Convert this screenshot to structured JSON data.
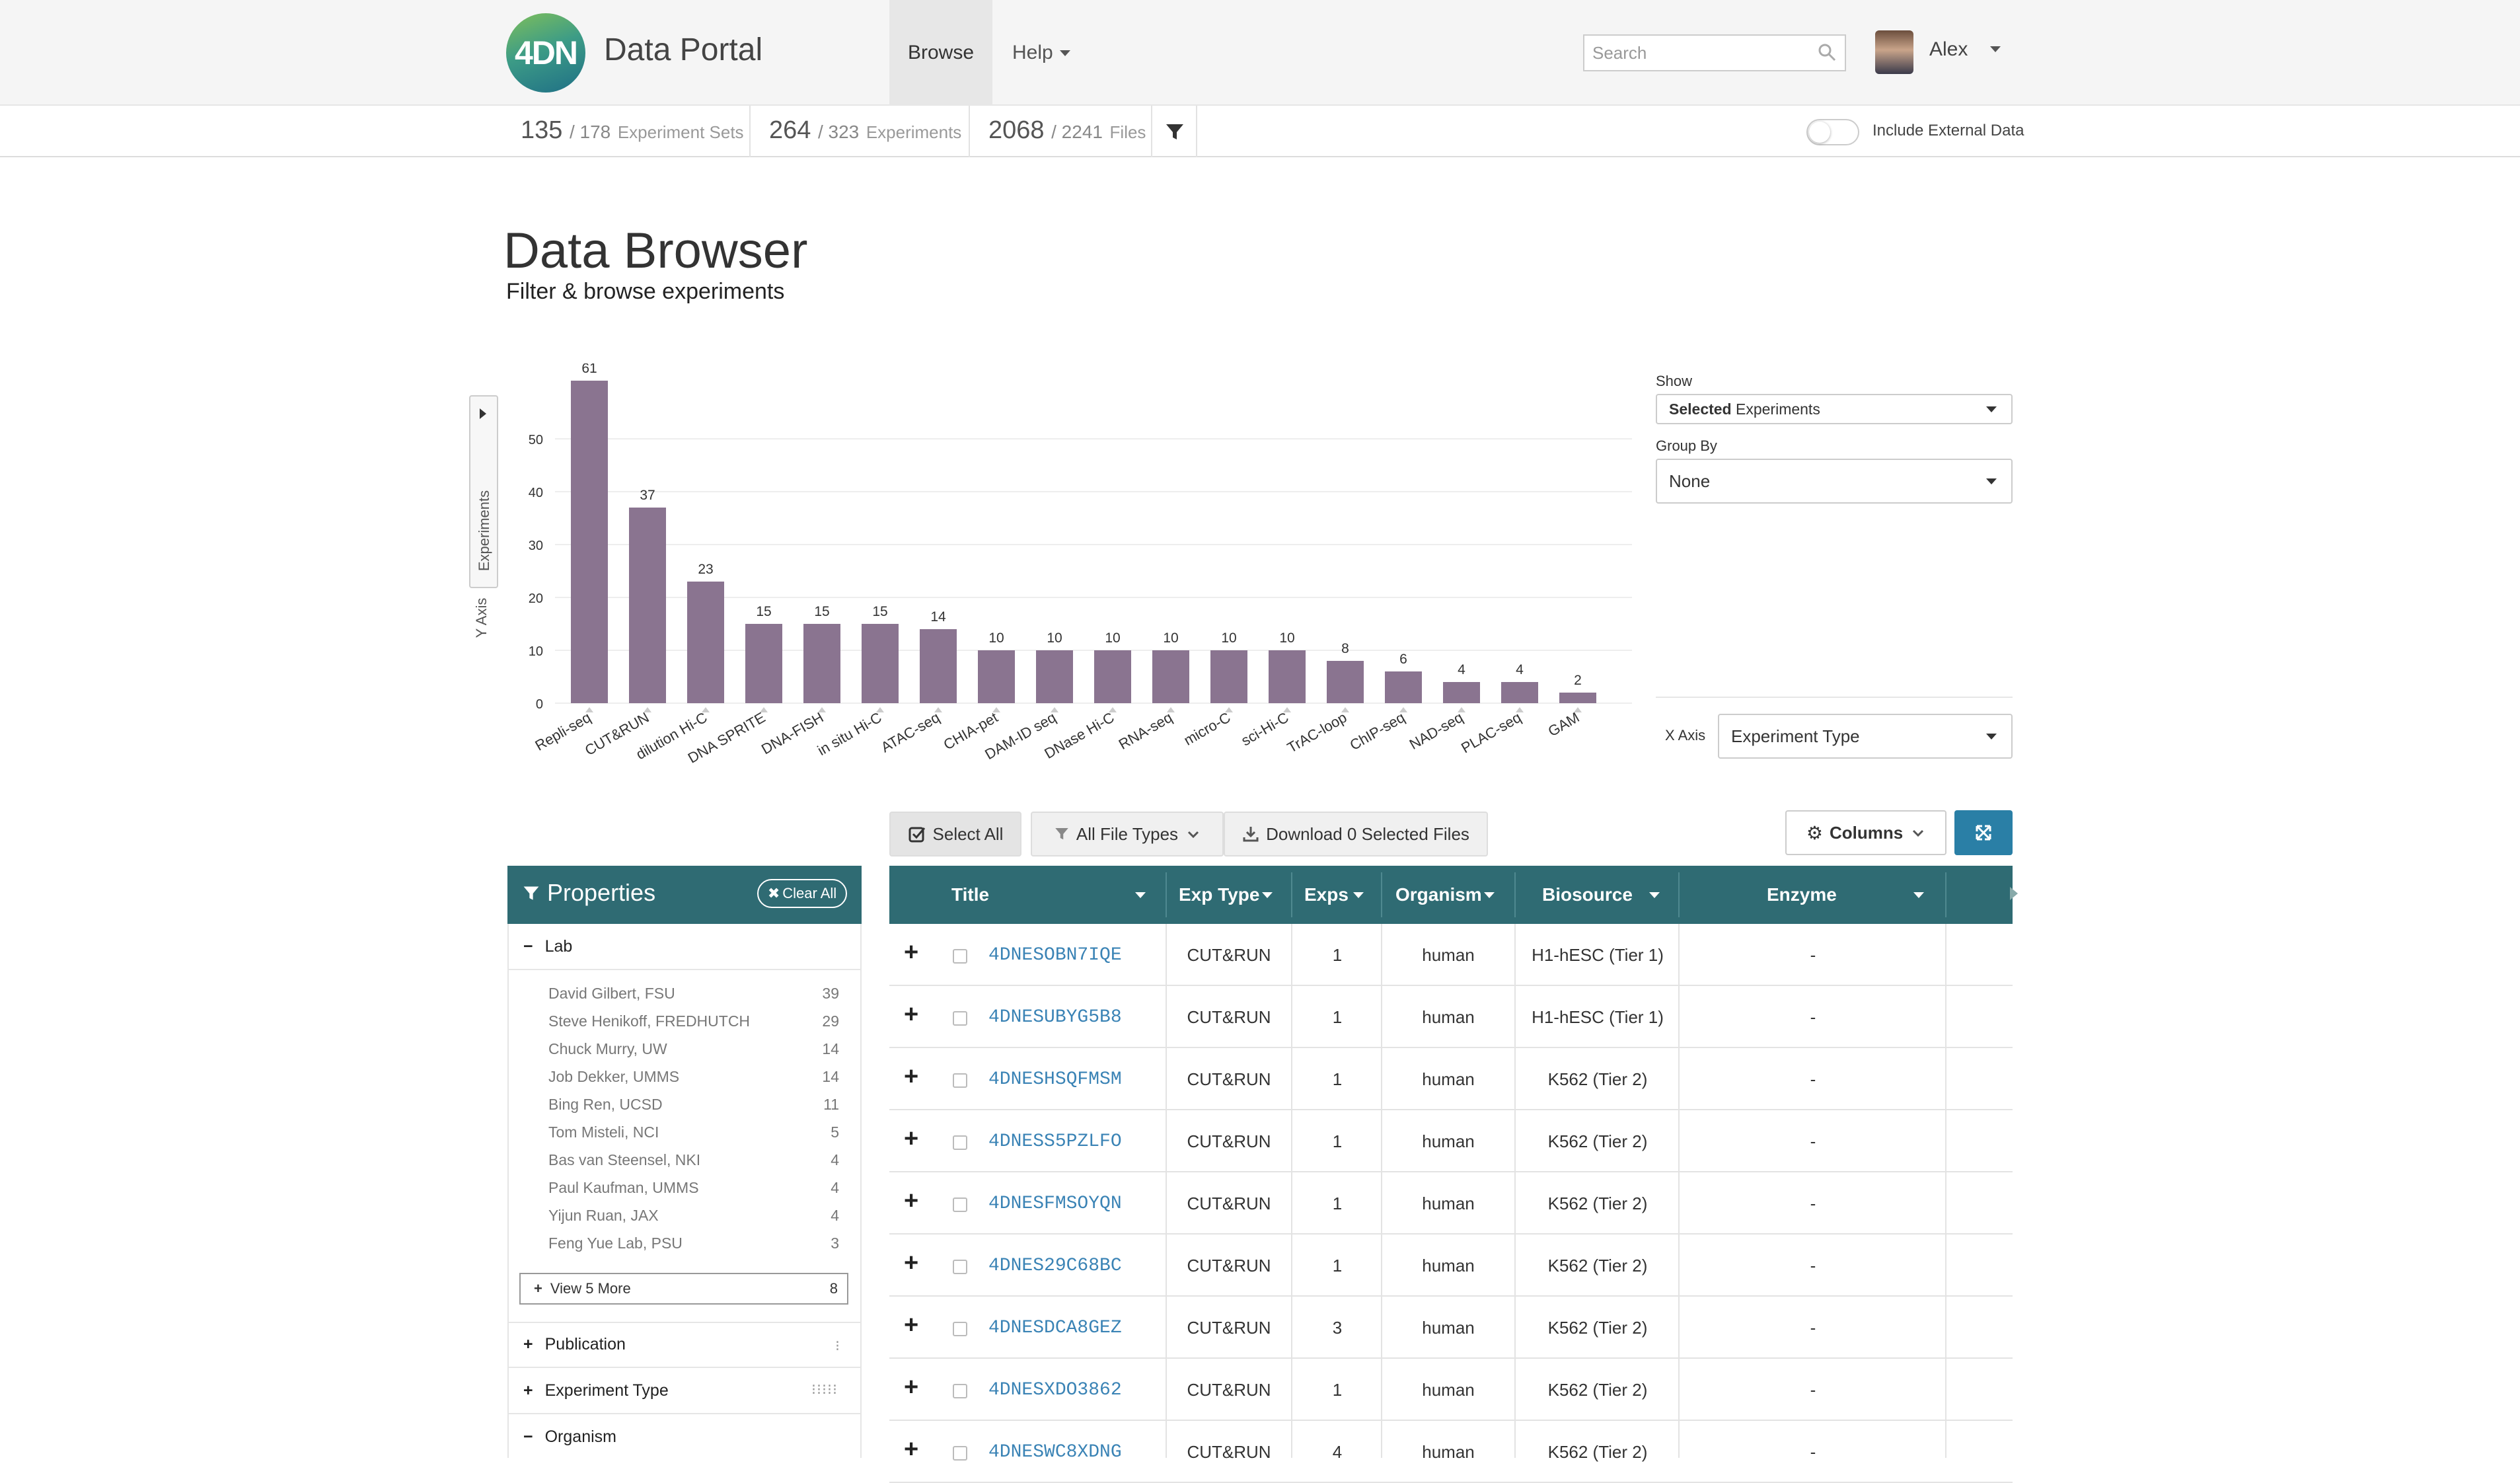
{
  "nav": {
    "logo_text": "4DN",
    "brand": "Data Portal",
    "browse": "Browse",
    "help": "Help",
    "search_placeholder": "Search",
    "user_name": "Alex"
  },
  "stats": {
    "experiment_sets": {
      "count": "135",
      "total": "/ 178",
      "label": "Experiment Sets"
    },
    "experiments": {
      "count": "264",
      "total": "/ 323",
      "label": "Experiments"
    },
    "files": {
      "count": "2068",
      "total": "/ 2241",
      "label": "Files"
    },
    "include_external": "Include External Data",
    "include_external_on": false
  },
  "page": {
    "title": "Data Browser",
    "subtitle": "Filter & browse experiments"
  },
  "chart_controls": {
    "y_axis_tab": "Experiments",
    "y_axis_label": "Y Axis",
    "show_label": "Show",
    "show_value_bold": "Selected",
    "show_value": "Experiments",
    "group_by_label": "Group By",
    "group_by_value": "None",
    "x_axis_label": "X Axis",
    "x_axis_value": "Experiment Type"
  },
  "chart_data": {
    "type": "bar",
    "categories": [
      "Repli-seq",
      "CUT&RUN",
      "dilution Hi-C",
      "DNA SPRITE",
      "DNA-FISH",
      "in situ Hi-C",
      "ATAC-seq",
      "CHIA-pet",
      "DAM-ID seq",
      "DNase Hi-C",
      "RNA-seq",
      "micro-C",
      "sci-Hi-C",
      "TrAC-loop",
      "ChIP-seq",
      "NAD-seq",
      "PLAC-seq",
      "GAM"
    ],
    "values": [
      61,
      37,
      23,
      15,
      15,
      15,
      14,
      10,
      10,
      10,
      10,
      10,
      10,
      8,
      6,
      4,
      4,
      2
    ],
    "ylim": [
      0,
      61
    ],
    "yticks": [
      0,
      10,
      20,
      30,
      40,
      50
    ],
    "ylabel": "Experiments",
    "bar_color": "#8a7490",
    "grid": true
  },
  "toolbar": {
    "select_all": "Select All",
    "file_types": "All File Types",
    "download": "Download 0 Selected Files",
    "columns": "Columns"
  },
  "properties": {
    "title": "Properties",
    "clear_all": "Clear All",
    "lab_heading": "Lab",
    "labs": [
      {
        "name": "David Gilbert, FSU",
        "count": "39"
      },
      {
        "name": "Steve Henikoff, FREDHUTCH",
        "count": "29"
      },
      {
        "name": "Chuck Murry, UW",
        "count": "14"
      },
      {
        "name": "Job Dekker, UMMS",
        "count": "14"
      },
      {
        "name": "Bing Ren, UCSD",
        "count": "11"
      },
      {
        "name": "Tom Misteli, NCI",
        "count": "5"
      },
      {
        "name": "Bas van Steensel, NKI",
        "count": "4"
      },
      {
        "name": "Paul Kaufman, UMMS",
        "count": "4"
      },
      {
        "name": "Yijun Ruan, JAX",
        "count": "4"
      },
      {
        "name": "Feng Yue Lab, PSU",
        "count": "3"
      }
    ],
    "view_more": "View 5 More",
    "view_more_count": "8",
    "publication": "Publication",
    "experiment_type": "Experiment Type",
    "organism": "Organism"
  },
  "table": {
    "headers": {
      "title": "Title",
      "exp_type": "Exp Type",
      "exps": "Exps",
      "organism": "Organism",
      "biosource": "Biosource",
      "enzyme": "Enzyme"
    },
    "rows": [
      {
        "accession": "4DNESOBN7IQE",
        "exp_type": "CUT&RUN",
        "exps": "1",
        "organism": "human",
        "biosource": "H1-hESC (Tier 1)",
        "enzyme": "-"
      },
      {
        "accession": "4DNESUBYG5B8",
        "exp_type": "CUT&RUN",
        "exps": "1",
        "organism": "human",
        "biosource": "H1-hESC (Tier 1)",
        "enzyme": "-"
      },
      {
        "accession": "4DNESHSQFMSM",
        "exp_type": "CUT&RUN",
        "exps": "1",
        "organism": "human",
        "biosource": "K562 (Tier 2)",
        "enzyme": "-"
      },
      {
        "accession": "4DNESS5PZLFO",
        "exp_type": "CUT&RUN",
        "exps": "1",
        "organism": "human",
        "biosource": "K562 (Tier 2)",
        "enzyme": "-"
      },
      {
        "accession": "4DNESFMSOYQN",
        "exp_type": "CUT&RUN",
        "exps": "1",
        "organism": "human",
        "biosource": "K562 (Tier 2)",
        "enzyme": "-"
      },
      {
        "accession": "4DNES29C68BC",
        "exp_type": "CUT&RUN",
        "exps": "1",
        "organism": "human",
        "biosource": "K562 (Tier 2)",
        "enzyme": "-"
      },
      {
        "accession": "4DNESDCA8GEZ",
        "exp_type": "CUT&RUN",
        "exps": "3",
        "organism": "human",
        "biosource": "K562 (Tier 2)",
        "enzyme": "-"
      },
      {
        "accession": "4DNESXDO3862",
        "exp_type": "CUT&RUN",
        "exps": "1",
        "organism": "human",
        "biosource": "K562 (Tier 2)",
        "enzyme": "-"
      },
      {
        "accession": "4DNESWC8XDNG",
        "exp_type": "CUT&RUN",
        "exps": "4",
        "organism": "human",
        "biosource": "K562 (Tier 2)",
        "enzyme": "-"
      }
    ]
  }
}
